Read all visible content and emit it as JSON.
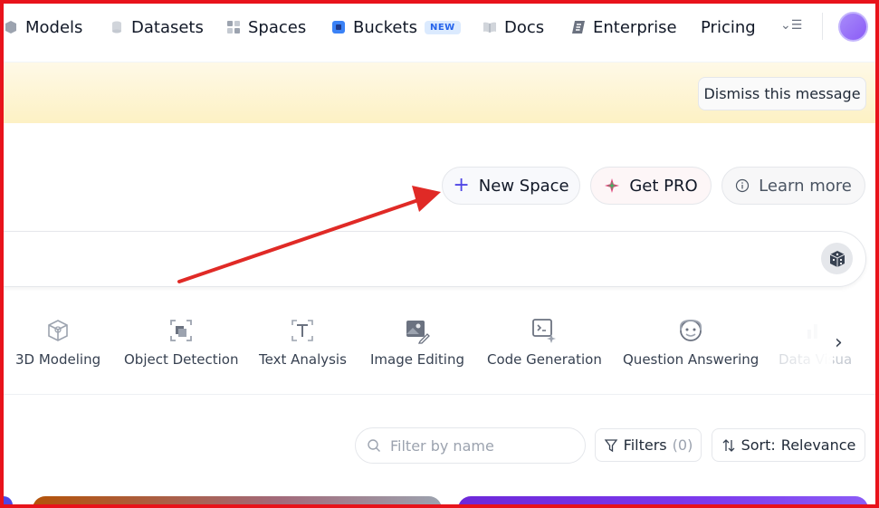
{
  "nav": {
    "items": [
      {
        "label": "Models",
        "icon": "cube-icon"
      },
      {
        "label": "Datasets",
        "icon": "database-icon"
      },
      {
        "label": "Spaces",
        "icon": "grid-icon"
      },
      {
        "label": "Buckets",
        "icon": "bucket-icon",
        "badge": "NEW"
      },
      {
        "label": "Docs",
        "icon": "book-icon"
      },
      {
        "label": "Enterprise",
        "icon": "enterprise-icon"
      },
      {
        "label": "Pricing"
      }
    ]
  },
  "banner": {
    "dismiss_label": "Dismiss this message"
  },
  "actions": {
    "new_space": "New Space",
    "get_pro": "Get PRO",
    "learn_more": "Learn more"
  },
  "categories": [
    {
      "label": "3D Modeling",
      "icon": "cube-outline-icon"
    },
    {
      "label": "Object Detection",
      "icon": "object-detection-icon"
    },
    {
      "label": "Text Analysis",
      "icon": "text-icon"
    },
    {
      "label": "Image Editing",
      "icon": "image-edit-icon"
    },
    {
      "label": "Code Generation",
      "icon": "code-icon"
    },
    {
      "label": "Question Answering",
      "icon": "chat-icon"
    },
    {
      "label": "Data Visua",
      "icon": "chart-icon"
    }
  ],
  "filter": {
    "placeholder": "Filter by name",
    "filters_label": "Filters",
    "filters_count": "(0)",
    "sort_label": "Sort:",
    "sort_value": "Relevance"
  },
  "colors": {
    "accent": "#4f46e5",
    "annotation": "#e02a26",
    "frame": "#e8131b"
  }
}
